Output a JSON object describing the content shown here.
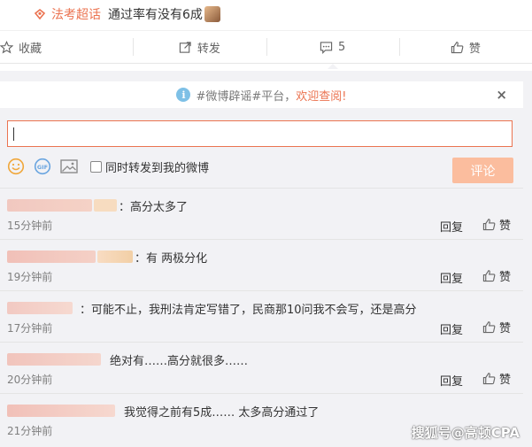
{
  "post": {
    "topic": "法考超话",
    "text": "通过率有没有6成"
  },
  "actions": [
    {
      "label": "收藏",
      "icon": "star-icon"
    },
    {
      "label": "转发",
      "icon": "share-icon"
    },
    {
      "label": "5",
      "icon": "comment-icon"
    },
    {
      "label": "赞",
      "icon": "thumbs-up-icon"
    }
  ],
  "notice": {
    "text": "#微博辟谣#平台，",
    "link": "欢迎查阅!",
    "close": "×"
  },
  "composer": {
    "checkbox_label": "同时转发到我的微博",
    "submit_label": "评论"
  },
  "comments": [
    {
      "sep": "：",
      "text": "高分太多了",
      "time": "15分钟前",
      "reply": "回复",
      "like": "赞"
    },
    {
      "sep": "：",
      "text": "有 两极分化",
      "time": "19分钟前",
      "reply": "回复",
      "like": "赞"
    },
    {
      "sep": "：",
      "text": "可能不止，我刑法肯定写错了，民商那10问我不会写，还是高分",
      "time": "17分钟前",
      "reply": "回复",
      "like": "赞"
    },
    {
      "sep": "",
      "text": "绝对有……高分就很多……",
      "time": "20分钟前",
      "reply": "回复",
      "like": "赞"
    },
    {
      "sep": "",
      "text": "我觉得之前有5成…… 太多高分通过了",
      "time": "21分钟前",
      "reply": "",
      "like": ""
    }
  ],
  "watermark": "搜狐号@高顿CPA",
  "colors": {
    "accent": "#eb7350",
    "submit_disabled": "#fbbd9e",
    "panel_bg": "#f2f2f5"
  }
}
